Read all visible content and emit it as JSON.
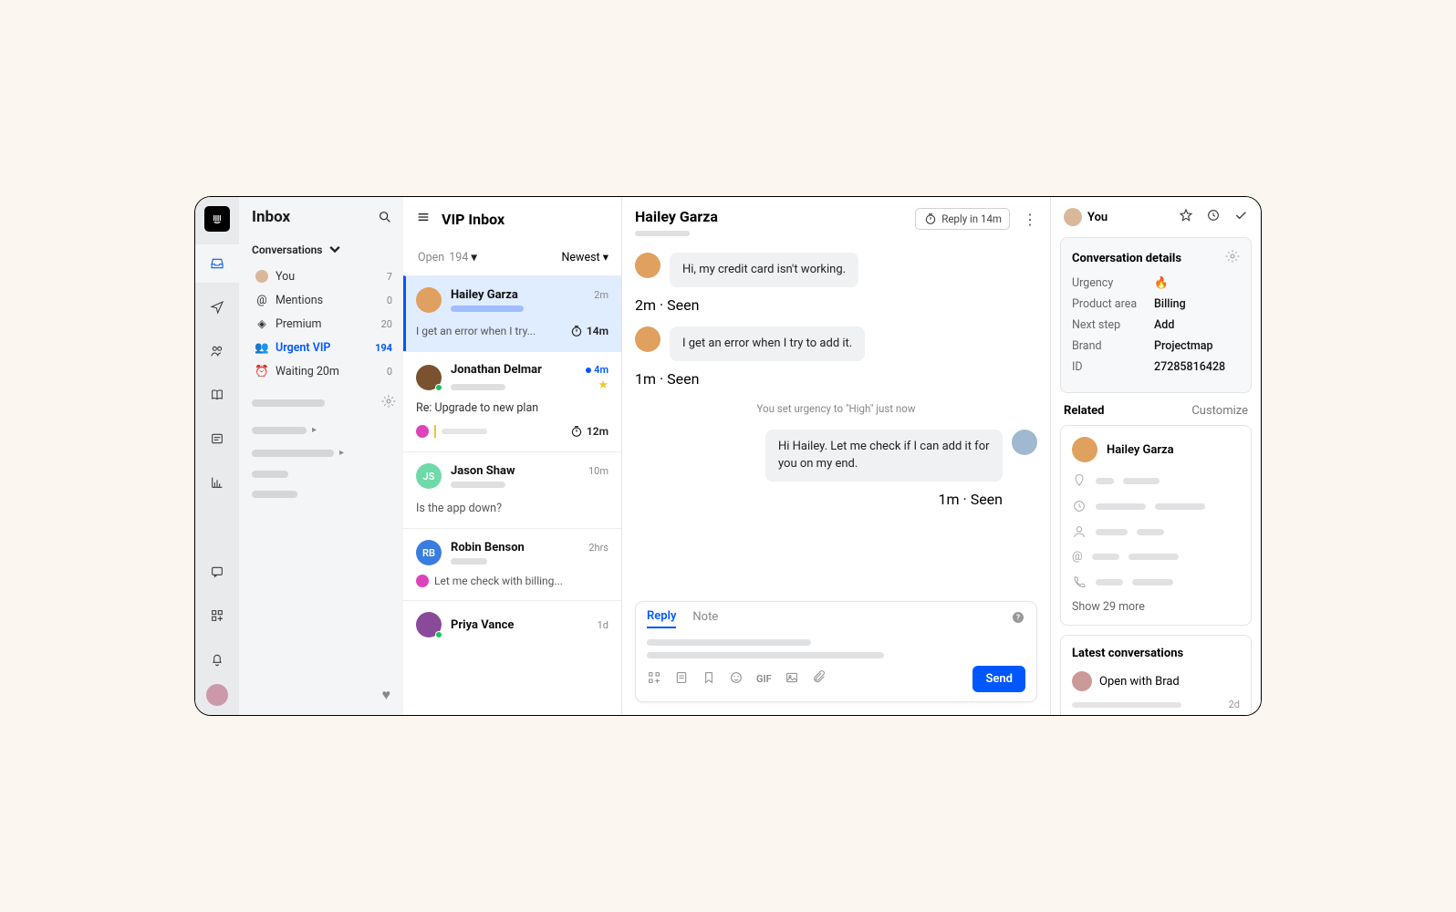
{
  "sidebar": {
    "title": "Inbox",
    "section": "Conversations",
    "items": [
      {
        "label": "You",
        "count": "7"
      },
      {
        "label": "Mentions",
        "count": "0"
      },
      {
        "label": "Premium",
        "count": "20"
      },
      {
        "label": "Urgent VIP",
        "count": "194"
      },
      {
        "label": "Waiting 20m",
        "count": "0"
      }
    ]
  },
  "list": {
    "title": "VIP Inbox",
    "open_label": "Open",
    "open_count": "194",
    "sort": "Newest",
    "conversations": [
      {
        "name": "Hailey Garza",
        "time": "2m",
        "preview": "I get an error when I try...",
        "sla": "14m"
      },
      {
        "name": "Jonathan Delmar",
        "time": "4m",
        "preview": "Re: Upgrade to new plan",
        "sla": "12m"
      },
      {
        "name": "Jason Shaw",
        "initials": "JS",
        "time": "10m",
        "preview": "Is the app down?"
      },
      {
        "name": "Robin Benson",
        "initials": "RB",
        "time": "2hrs",
        "preview": "Let me check with billing..."
      },
      {
        "name": "Priya Vance",
        "time": "1d",
        "preview": ""
      }
    ]
  },
  "thread": {
    "title": "Hailey Garza",
    "reply_pill": "Reply in 14m",
    "messages": [
      {
        "text": "Hi, my credit card isn't working.",
        "meta": "2m · Seen"
      },
      {
        "text": "I get an error when I try to add it.",
        "meta": "1m · Seen"
      }
    ],
    "system": "You set urgency to \"High\" just now",
    "out_message": {
      "text": "Hi Hailey. Let me check if I can add it for you on my end.",
      "meta": "1m · Seen"
    },
    "composer": {
      "tabs": {
        "reply": "Reply",
        "note": "Note"
      },
      "gif": "GIF",
      "send": "Send"
    }
  },
  "right": {
    "you": "You",
    "details": {
      "title": "Conversation details",
      "urgency_label": "Urgency",
      "urgency_value": "🔥",
      "area_label": "Product area",
      "area_value": "Billing",
      "next_label": "Next step",
      "next_value": "Add",
      "brand_label": "Brand",
      "brand_value": "Projectmap",
      "id_label": "ID",
      "id_value": "27285816428"
    },
    "related": {
      "title": "Related",
      "customize": "Customize"
    },
    "contact": {
      "name": "Hailey Garza",
      "more": "Show 29 more"
    },
    "latest": {
      "title": "Latest conversations",
      "item": "Open with Brad",
      "time": "2d"
    }
  }
}
